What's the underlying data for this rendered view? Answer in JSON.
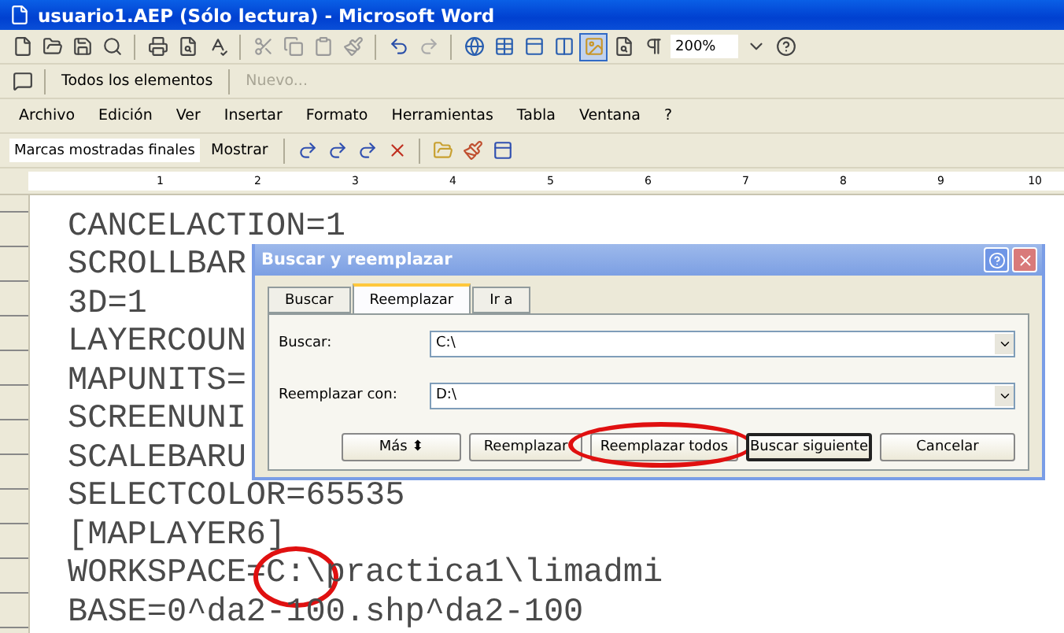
{
  "window": {
    "title": "usuario1.AEP (Sólo lectura) - Microsoft Word"
  },
  "standard_toolbar": {
    "zoom": "200%"
  },
  "reviewing_toolbar": {
    "elements": "Todos los elementos",
    "new_comment": {
      "label": "Nuevo...",
      "disabled": true
    }
  },
  "menu": [
    "Archivo",
    "Edición",
    "Ver",
    "Insertar",
    "Formato",
    "Herramientas",
    "Tabla",
    "Ventana",
    "?"
  ],
  "markup_toolbar": {
    "display": "Marcas mostradas finales",
    "show": "Mostrar"
  },
  "ruler": {
    "numbers": [
      "1",
      "2",
      "3",
      "4",
      "5",
      "6",
      "7",
      "8",
      "9",
      "10"
    ]
  },
  "document": {
    "lines": [
      {
        "parts": [
          {
            "text": "CANCELACTION=1",
            "circled": false
          }
        ]
      },
      {
        "parts": [
          {
            "text": "SCROLLBAR",
            "circled": false
          }
        ]
      },
      {
        "parts": [
          {
            "text": "3D=1",
            "circled": false
          }
        ]
      },
      {
        "parts": [
          {
            "text": "LAYERCOUN",
            "circled": false
          }
        ]
      },
      {
        "parts": [
          {
            "text": "MAPUNITS=",
            "circled": false
          }
        ]
      },
      {
        "parts": [
          {
            "text": "SCREENUNI",
            "circled": false
          }
        ]
      },
      {
        "parts": [
          {
            "text": "SCALEBARU",
            "circled": false
          }
        ]
      },
      {
        "parts": [
          {
            "text": "SELECTCOLOR=65535",
            "circled": false
          }
        ]
      },
      {
        "parts": [
          {
            "text": "[MAPLAYER6]",
            "circled": false
          }
        ]
      },
      {
        "parts": [
          {
            "text": "WORKSPACE=",
            "circled": false
          },
          {
            "text": "C:\\",
            "circled": true
          },
          {
            "text": "practica1\\limadmi",
            "circled": false
          }
        ]
      },
      {
        "parts": [
          {
            "text": "BASE=0^da2-100.shp^da2-100",
            "circled": false
          }
        ]
      }
    ]
  },
  "dialog": {
    "title": "Buscar y reemplazar",
    "tabs": [
      {
        "label": "Buscar",
        "selected": false
      },
      {
        "label": "Reemplazar",
        "selected": true
      },
      {
        "label": "Ir a",
        "selected": false
      }
    ],
    "fields": [
      {
        "label": "Buscar:",
        "value": "C:\\"
      },
      {
        "label": "Reemplazar con:",
        "value": "D:\\"
      }
    ],
    "buttons": [
      {
        "label": "Más ⬍",
        "circled": false,
        "default": false
      },
      {
        "label": "Reemplazar",
        "circled": false,
        "default": false
      },
      {
        "label": "Reemplazar todos",
        "circled": true,
        "default": false
      },
      {
        "label": "Buscar siguiente",
        "circled": false,
        "default": true
      },
      {
        "label": "Cancelar",
        "circled": false,
        "default": false
      }
    ]
  }
}
